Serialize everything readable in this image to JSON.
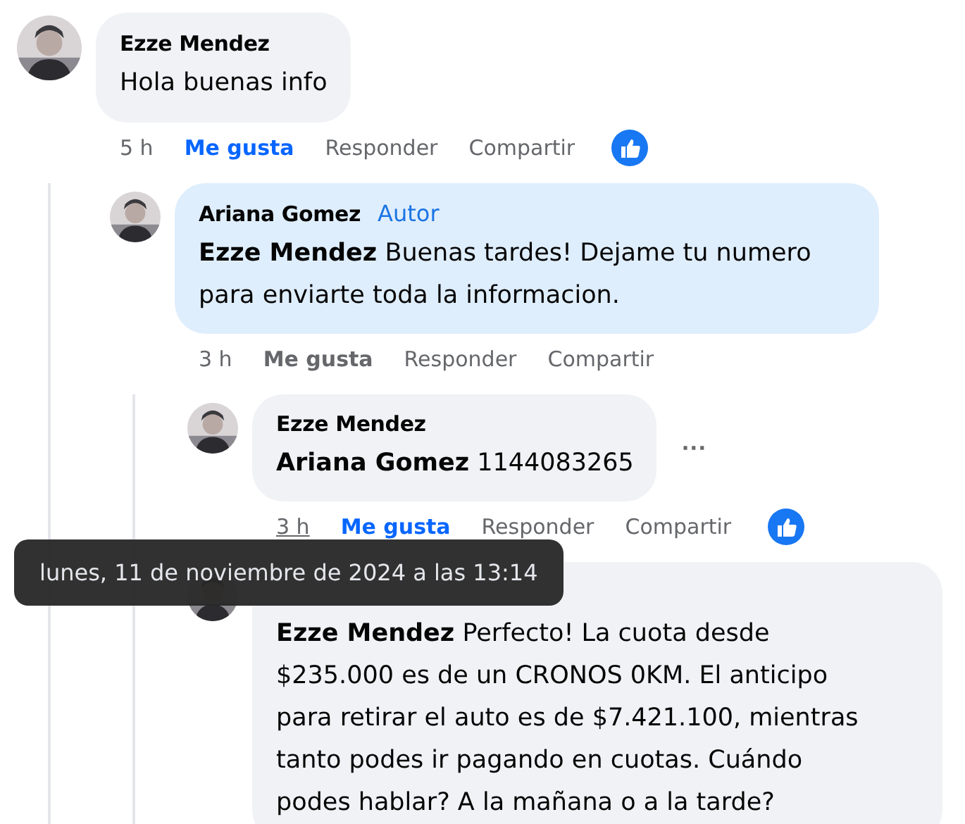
{
  "comments": [
    {
      "author": "Ezze Mendez",
      "text": "Hola buenas info",
      "highlighted": false,
      "time": "5 h",
      "hovered": false,
      "like_label": "Me gusta",
      "liked": true,
      "reply_label": "Responder",
      "share_label": "Compartir",
      "reaction": true,
      "children": [
        {
          "author": "Ariana Gomez",
          "badge": "Autor",
          "text": "**Ezze Mendez** Buenas tardes! Dejame tu numero para enviarte toda la informacion.",
          "highlighted": true,
          "time": "3 h",
          "hovered": false,
          "like_label": "Me gusta",
          "liked": false,
          "reply_label": "Responder",
          "share_label": "Compartir",
          "reaction": false,
          "children": [
            {
              "author": "Ezze Mendez",
              "text": "**Ariana Gomez** 1144083265",
              "highlighted": false,
              "more": "···",
              "time": "3 h",
              "hovered": true,
              "like_label": "Me gusta",
              "liked": true,
              "reply_label": "Responder",
              "share_label": "Compartir",
              "reaction": true
            },
            {
              "text": "**Ezze Mendez** Perfecto! La cuota desde $235.000 es de un CRONOS 0KM. El anticipo para retirar el auto es de $7.421.100, mientras tanto podes ir pagando en cuotas. Cuándo podes hablar? A la mañana o a la tarde?",
              "highlighted": false
            }
          ]
        }
      ]
    }
  ],
  "tooltip": "lunes, 11 de noviembre de 2024 a las 13:14"
}
